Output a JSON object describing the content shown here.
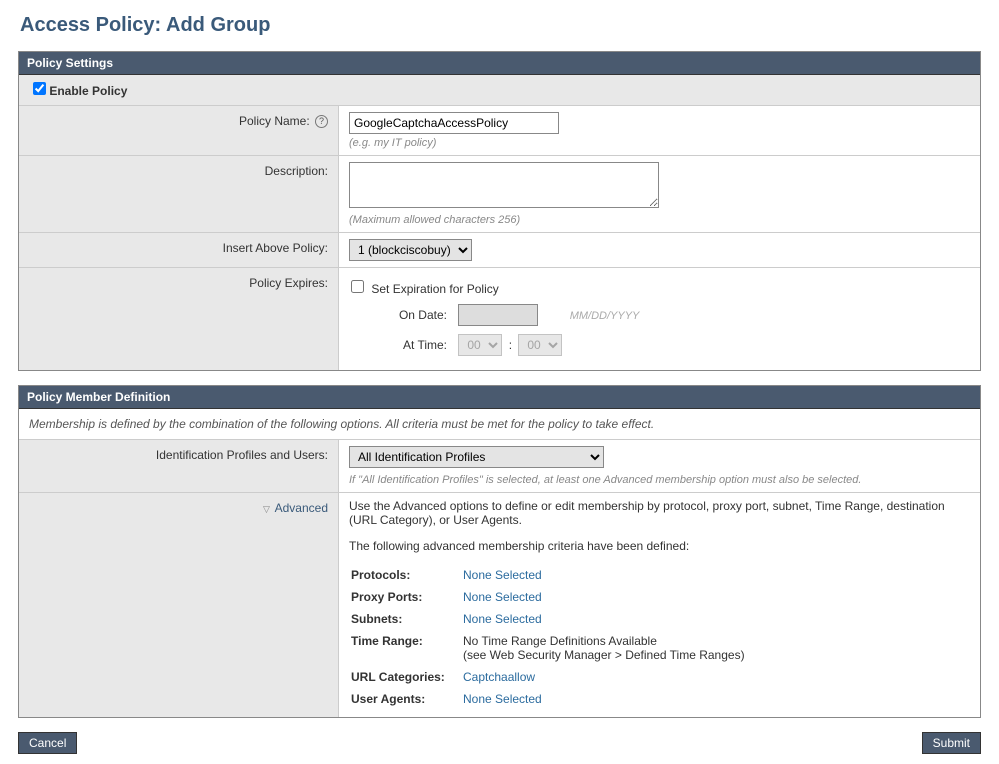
{
  "page_title": "Access Policy: Add Group",
  "settings": {
    "header": "Policy Settings",
    "enable_label": "Enable Policy",
    "enable_checked": true,
    "name_label": "Policy Name:",
    "name_value": "GoogleCaptchaAccessPolicy",
    "name_hint": "(e.g. my IT policy)",
    "desc_label": "Description:",
    "desc_value": "",
    "desc_hint": "(Maximum allowed characters 256)",
    "insert_label": "Insert Above Policy:",
    "insert_value": "1 (blockciscobuy)",
    "expires_label": "Policy Expires:",
    "set_exp_label": "Set Expiration for Policy",
    "on_date_label": "On Date:",
    "date_format_hint": "MM/DD/YYYY",
    "at_time_label": "At Time:",
    "time_hour": "00",
    "time_min": "00"
  },
  "member": {
    "header": "Policy Member Definition",
    "note": "Membership is defined by the combination of the following options. All criteria must be met for the policy to take effect.",
    "ident_label": "Identification Profiles and Users:",
    "ident_value": "All Identification Profiles",
    "ident_hint": "If \"All Identification Profiles\" is selected, at least one Advanced membership option must also be selected.",
    "advanced_label": "Advanced",
    "advanced_intro": "Use the Advanced options to define or edit membership by protocol, proxy port, subnet, Time Range, destination (URL Category), or User Agents.",
    "advanced_defined": "The following advanced membership criteria have been defined:",
    "criteria": {
      "protocols_label": "Protocols:",
      "protocols_value": "None Selected",
      "proxy_ports_label": "Proxy Ports:",
      "proxy_ports_value": "None Selected",
      "subnets_label": "Subnets:",
      "subnets_value": "None Selected",
      "time_range_label": "Time Range:",
      "time_range_value": "No Time Range Definitions Available",
      "time_range_sub": "(see Web Security Manager > Defined Time Ranges)",
      "url_cat_label": "URL Categories:",
      "url_cat_value": "Captchaallow",
      "user_agents_label": "User Agents:",
      "user_agents_value": "None Selected"
    }
  },
  "buttons": {
    "cancel": "Cancel",
    "submit": "Submit"
  }
}
